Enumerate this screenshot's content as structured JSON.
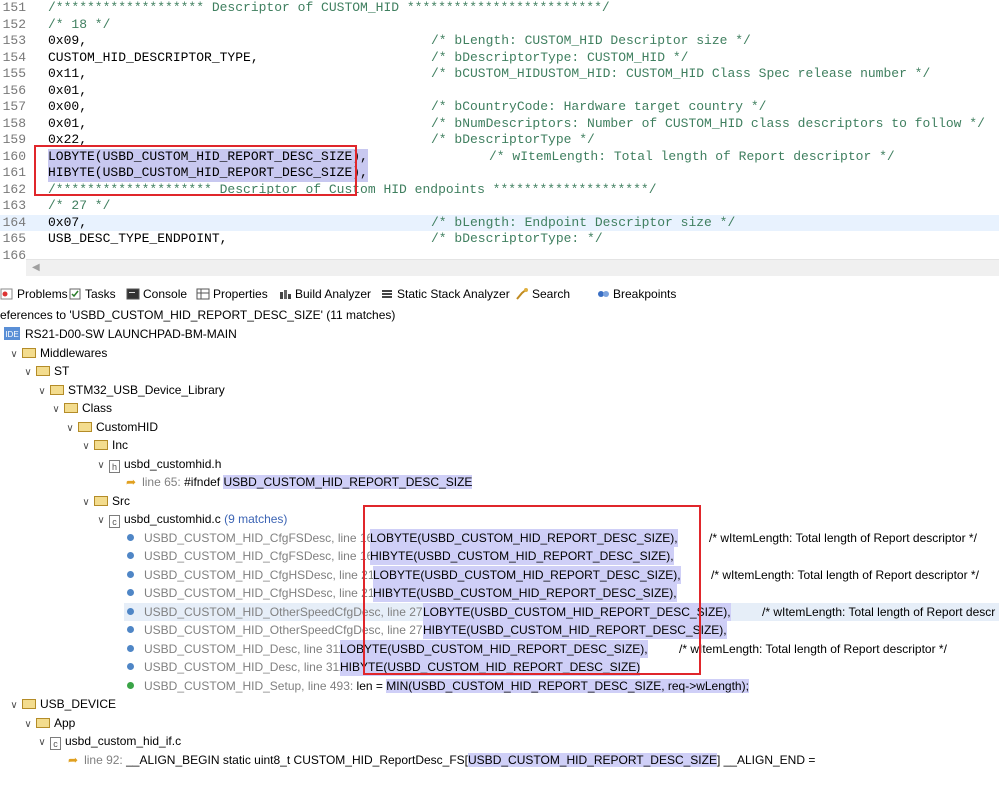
{
  "editor": {
    "lines": [
      {
        "num": "151",
        "code": "/******************* Descriptor of CUSTOM_HID *************************/",
        "comment": ""
      },
      {
        "num": "152",
        "code": "/* 18 */",
        "comment": ""
      },
      {
        "num": "153",
        "code": "0x09,",
        "comment": "/* bLength: CUSTOM_HID Descriptor size */"
      },
      {
        "num": "154",
        "code": "CUSTOM_HID_DESCRIPTOR_TYPE,",
        "comment": "/* bDescriptorType: CUSTOM_HID */"
      },
      {
        "num": "155",
        "code": "0x11,",
        "comment": "/* bCUSTOM_HIDUSTOM_HID: CUSTOM_HID Class Spec release number */"
      },
      {
        "num": "156",
        "code": "0x01,",
        "comment": ""
      },
      {
        "num": "157",
        "code": "0x00,",
        "comment": "/* bCountryCode: Hardware target country */"
      },
      {
        "num": "158",
        "code": "0x01,",
        "comment": "/* bNumDescriptors: Number of CUSTOM_HID class descriptors to follow */"
      },
      {
        "num": "159",
        "code": "0x22,",
        "comment": "/* bDescriptorType */"
      },
      {
        "num": "160",
        "code": "LOBYTE(USBD_CUSTOM_HID_REPORT_DESC_SIZE),",
        "comment": "/* wItemLength: Total length of Report descriptor */"
      },
      {
        "num": "161",
        "code": "HIBYTE(USBD_CUSTOM_HID_REPORT_DESC_SIZE),",
        "comment": ""
      },
      {
        "num": "162",
        "code": "/******************** Descriptor of Custom HID endpoints ********************/",
        "comment": ""
      },
      {
        "num": "163",
        "code": "/* 27 */",
        "comment": ""
      },
      {
        "num": "164",
        "code": "0x07,",
        "comment": "/* bLength: Endpoint Descriptor size */"
      },
      {
        "num": "165",
        "code": "USB_DESC_TYPE_ENDPOINT,",
        "comment": "/* bDescriptorType: */"
      },
      {
        "num": "166",
        "code": "",
        "comment": ""
      }
    ]
  },
  "tabs": [
    {
      "label": "Problems",
      "icon": "problems-icon"
    },
    {
      "label": "Tasks",
      "icon": "tasks-icon"
    },
    {
      "label": "Console",
      "icon": "console-icon"
    },
    {
      "label": "Properties",
      "icon": "properties-icon"
    },
    {
      "label": "Build Analyzer",
      "icon": "build-analyzer-icon"
    },
    {
      "label": "Static Stack Analyzer",
      "icon": "static-stack-analyzer-icon"
    },
    {
      "label": "Search",
      "icon": "search-icon"
    },
    {
      "label": "Breakpoints",
      "icon": "breakpoints-icon"
    }
  ],
  "search": {
    "header": "eferences to 'USBD_CUSTOM_HID_REPORT_DESC_SIZE' (11 matches)",
    "project": "RS21-D00-SW LAUNCHPAD-BM-MAIN",
    "project_badge": "IDE",
    "folders": {
      "middlewares": "Middlewares",
      "st": "ST",
      "library": "STM32_USB_Device_Library",
      "class": "Class",
      "customhid": "CustomHID",
      "inc": "Inc",
      "src": "Src",
      "usb_device": "USB_DEVICE",
      "app": "App"
    },
    "files": {
      "h_name": "usbd_customhid.h",
      "h_badge": "h",
      "c_name": "usbd_customhid.c",
      "c_badge": "c",
      "c_count": "(9 matches)",
      "if_name": "usbd_custom_hid_if.c",
      "if_badge": "c"
    },
    "h_match": {
      "loc": "line 65:",
      "pre": "#ifndef ",
      "hl": "USBD_CUSTOM_HID_REPORT_DESC_SIZE",
      "post": ""
    },
    "c_matches": [
      {
        "fn": "USBD_CUSTOM_HID_CfgFSDesc, line 160:",
        "code": "LOBYTE(USBD_CUSTOM_HID_REPORT_DESC_SIZE),",
        "comment": "/* wItemLength: Total length of Report descriptor */"
      },
      {
        "fn": "USBD_CUSTOM_HID_CfgFSDesc, line 161:",
        "code": "HIBYTE(USBD_CUSTOM_HID_REPORT_DESC_SIZE),",
        "comment": ""
      },
      {
        "fn": "USBD_CUSTOM_HID_CfgHSDesc, line 218:",
        "code": "LOBYTE(USBD_CUSTOM_HID_REPORT_DESC_SIZE),",
        "comment": "/* wItemLength: Total length of Report descriptor */"
      },
      {
        "fn": "USBD_CUSTOM_HID_CfgHSDesc, line 219:",
        "code": "HIBYTE(USBD_CUSTOM_HID_REPORT_DESC_SIZE),",
        "comment": ""
      },
      {
        "fn": "USBD_CUSTOM_HID_OtherSpeedCfgDesc, line 276:",
        "code": "LOBYTE(USBD_CUSTOM_HID_REPORT_DESC_SIZE),",
        "comment": "/* wItemLength: Total length of Report descr"
      },
      {
        "fn": "USBD_CUSTOM_HID_OtherSpeedCfgDesc, line 277:",
        "code": "HIBYTE(USBD_CUSTOM_HID_REPORT_DESC_SIZE),",
        "comment": ""
      },
      {
        "fn": "USBD_CUSTOM_HID_Desc, line 311:",
        "code": "LOBYTE(USBD_CUSTOM_HID_REPORT_DESC_SIZE),",
        "comment": "/* wItemLength: Total length of Report descriptor */"
      },
      {
        "fn": "USBD_CUSTOM_HID_Desc, line 312:",
        "code": "HIBYTE(USBD_CUSTOM_HID_REPORT_DESC_SIZE)",
        "comment": ""
      }
    ],
    "setup_match": {
      "fn": "USBD_CUSTOM_HID_Setup, line 493:",
      "pre": "len = ",
      "hl": "MIN(USBD_CUSTOM_HID_REPORT_DESC_SIZE, req->wLength);"
    },
    "if_match": {
      "loc": "line 92:",
      "pre": "__ALIGN_BEGIN static uint8_t CUSTOM_HID_ReportDesc_FS[",
      "hl": "USBD_CUSTOM_HID_REPORT_DESC_SIZE",
      "post": "] __ALIGN_END ="
    }
  }
}
